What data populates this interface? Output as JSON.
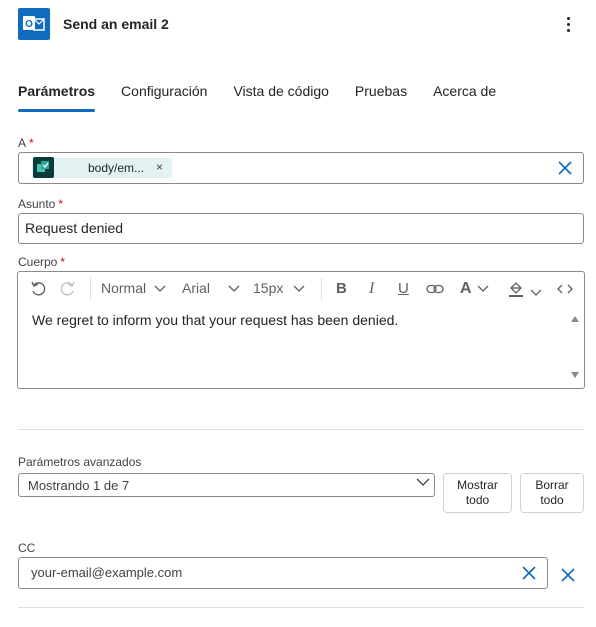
{
  "header": {
    "title": "Send an email 2",
    "app_icon": "outlook-icon",
    "menu_icon": "more-vertical-icon"
  },
  "tabs": [
    {
      "label": "Parámetros",
      "active": true
    },
    {
      "label": "Configuración",
      "active": false
    },
    {
      "label": "Vista de código",
      "active": false
    },
    {
      "label": "Pruebas",
      "active": false
    },
    {
      "label": "Acerca de",
      "active": false
    }
  ],
  "to": {
    "label": "A",
    "required": "*",
    "token_text": "body/em...",
    "token_remove": "×"
  },
  "subject": {
    "label": "Asunto",
    "required": "*",
    "value": "Request denied"
  },
  "body": {
    "label": "Cuerpo",
    "required": "*",
    "toolbar": {
      "style": "Normal",
      "font": "Arial",
      "size": "15px",
      "bold": "B",
      "italic": "I",
      "underline": "U",
      "font_color": "A"
    },
    "text": "We regret to inform you that your request has been denied."
  },
  "advanced": {
    "label": "Parámetros avanzados",
    "select_value": "Mostrando 1 de 7",
    "show_all_line1": "Mostrar",
    "show_all_line2": "todo",
    "clear_all_line1": "Borrar",
    "clear_all_line2": "todo"
  },
  "cc": {
    "label": "CC",
    "placeholder": "your-email@example.com"
  },
  "colors": {
    "accent": "#0f6cbd",
    "required": "#c50f1f",
    "token_bg": "#e3f2f2"
  }
}
